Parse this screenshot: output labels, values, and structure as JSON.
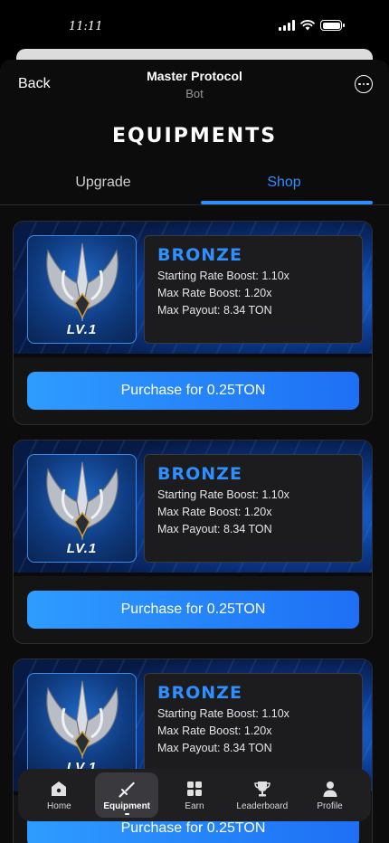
{
  "status_bar": {
    "time": "11:11"
  },
  "header": {
    "back_label": "Back",
    "title": "Master Protocol",
    "subtitle": "Bot"
  },
  "page": {
    "title": "EQUIPMENTS"
  },
  "tabs": [
    {
      "label": "Upgrade",
      "active": false
    },
    {
      "label": "Shop",
      "active": true
    }
  ],
  "items": [
    {
      "level": "LV.1",
      "tier": "BRONZE",
      "starting_rate": "Starting Rate Boost: 1.10x",
      "max_rate": "Max Rate Boost: 1.20x",
      "max_payout": "Max Payout: 8.34 TON",
      "button": "Purchase for 0.25TON"
    },
    {
      "level": "LV.1",
      "tier": "BRONZE",
      "starting_rate": "Starting Rate Boost: 1.10x",
      "max_rate": "Max Rate Boost: 1.20x",
      "max_payout": "Max Payout: 8.34 TON",
      "button": "Purchase for 0.25TON"
    },
    {
      "level": "LV.1",
      "tier": "BRONZE",
      "starting_rate": "Starting Rate Boost: 1.10x",
      "max_rate": "Max Rate Boost: 1.20x",
      "max_payout": "Max Payout: 8.34 TON",
      "button": "Purchase for 0.25TON"
    }
  ],
  "nav": [
    {
      "label": "Home",
      "icon": "home-icon",
      "active": false
    },
    {
      "label": "Equipment",
      "icon": "sword-icon",
      "active": true
    },
    {
      "label": "Earn",
      "icon": "grid-icon",
      "active": false
    },
    {
      "label": "Leaderboard",
      "icon": "trophy-icon",
      "active": false
    },
    {
      "label": "Profile",
      "icon": "user-icon",
      "active": false
    }
  ],
  "colors": {
    "accent": "#2e8fff",
    "background": "#0c0c0d",
    "card": "#141414",
    "button_start": "#2e9cff",
    "button_end": "#1e6ff5"
  }
}
